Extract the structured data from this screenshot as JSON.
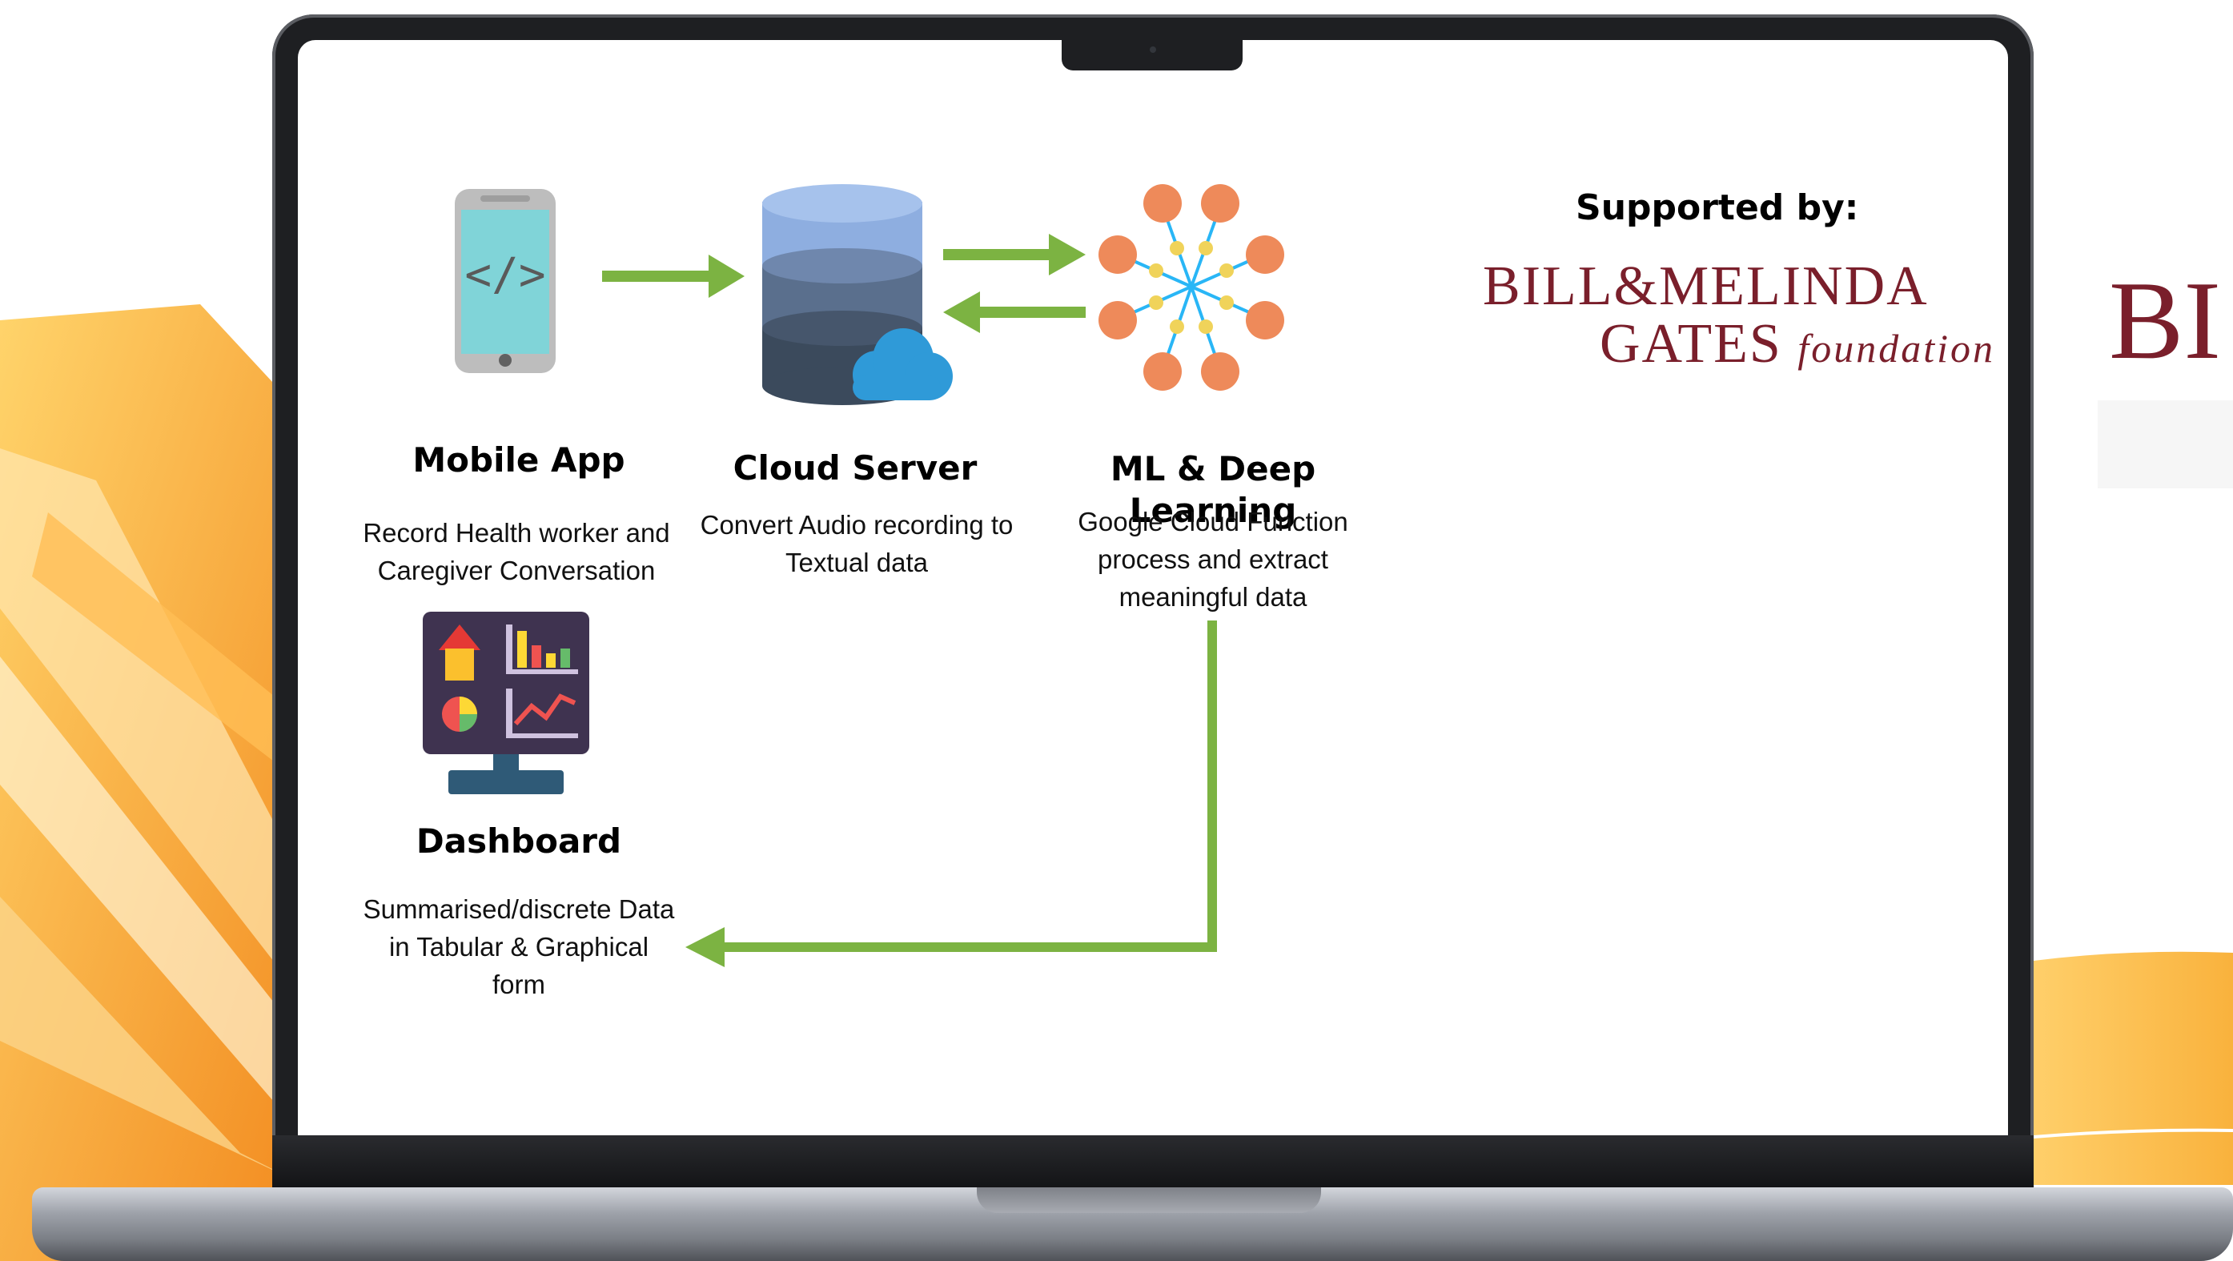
{
  "colors": {
    "arrow_green": "#7cb342",
    "brand_maroon": "#7a1f2b",
    "bg_orange": "#f7a233",
    "laptop_frame": "#1e1f22"
  },
  "diagram": {
    "nodes": [
      {
        "id": "mobile",
        "icon": "mobile-code-icon",
        "title": "Mobile App",
        "desc_lines": [
          "Record Health worker and",
          "Caregiver Conversation"
        ]
      },
      {
        "id": "cloud",
        "icon": "cloud-database-icon",
        "title": "Cloud Server",
        "desc_lines": [
          "Convert Audio recording to",
          "Textual data"
        ]
      },
      {
        "id": "ml",
        "icon": "neural-network-icon",
        "title_lines": [
          "ML & Deep",
          "Learning"
        ],
        "desc_lines": [
          "Google Cloud Function",
          "process and extract",
          "meaningful  data"
        ]
      },
      {
        "id": "dashboard",
        "icon": "dashboard-monitor-icon",
        "title": "Dashboard",
        "desc_lines": [
          "Summarised/discrete Data",
          "in Tabular & Graphical",
          "form"
        ]
      }
    ],
    "edges": [
      {
        "from": "mobile",
        "to": "cloud"
      },
      {
        "from": "cloud",
        "to": "ml"
      },
      {
        "from": "ml",
        "to": "cloud"
      },
      {
        "from": "ml",
        "to": "dashboard"
      }
    ]
  },
  "sponsor": {
    "label": "Supported by:",
    "logo_line1": "BILL&MELINDA",
    "logo_line2": "GATES",
    "logo_line2_italic": "foundation",
    "side_fragment": "BI"
  }
}
